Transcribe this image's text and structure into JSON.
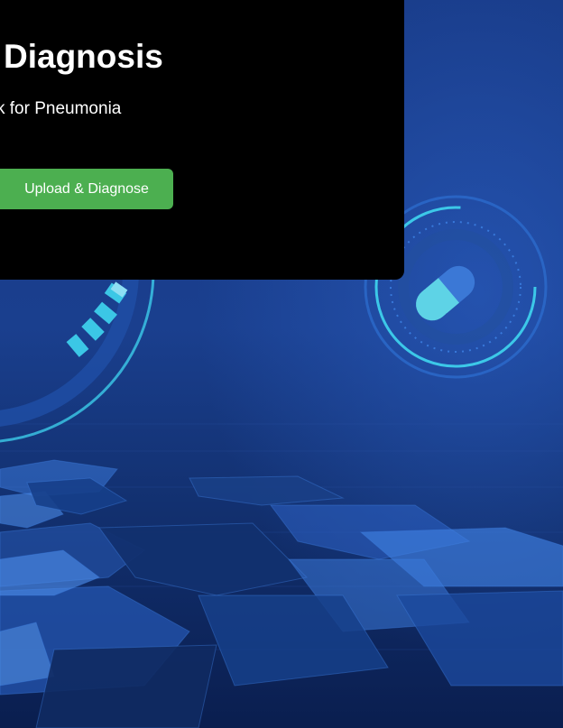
{
  "hero": {
    "title_visible": "Diagnosis",
    "subtitle_visible": "k for Pneumonia",
    "upload_button_label": "Upload & Diagnose"
  },
  "colors": {
    "panel_background": "#000000",
    "button_background": "#4caf50",
    "button_text": "#ffffff",
    "page_background": "#0d2a66",
    "accent_cyan": "#3fd6f0"
  },
  "icons": {
    "background_capsule": "capsule-icon"
  }
}
